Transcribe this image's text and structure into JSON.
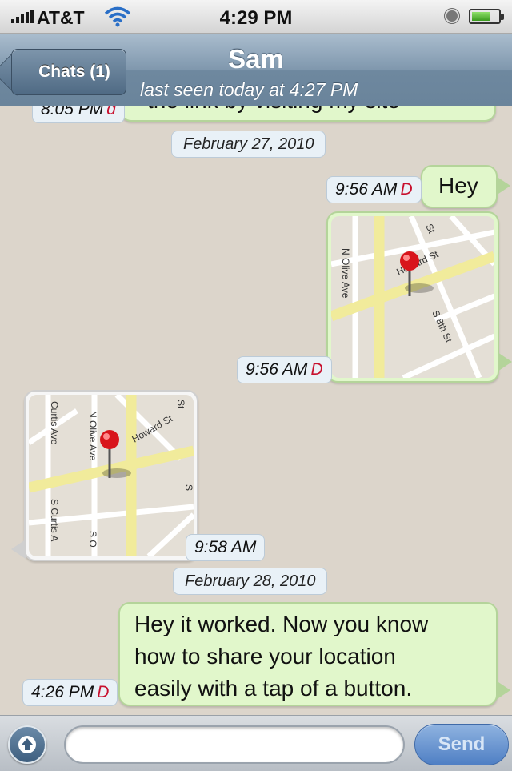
{
  "status_bar": {
    "carrier": "AT&T",
    "time": "4:29 PM"
  },
  "nav": {
    "back_label": "Chats (1)",
    "contact_name": "Sam",
    "last_seen": "last seen today at 4:27 PM"
  },
  "messages": {
    "partial_top": {
      "text": "the link by visiting my site",
      "time": "8:05 PM",
      "status": "d"
    },
    "date_1": "February 27, 2010",
    "msg_hey": {
      "text": "Hey",
      "time": "9:56 AM",
      "status": "D"
    },
    "map_out": {
      "time": "9:56 AM",
      "status": "D",
      "streets": [
        "N Olive Ave",
        "Howard St",
        "S 8th St",
        "St"
      ]
    },
    "map_in": {
      "time": "9:58 AM",
      "streets": [
        "Curtis Ave",
        "N Olive Ave",
        "Howard St",
        "S Curtis A",
        "S O",
        "St",
        "S"
      ]
    },
    "date_2": "February 28, 2010",
    "msg_worked": {
      "lines": [
        "Hey it worked.  Now you know",
        "how to share your location",
        "easily with a tap of a button."
      ],
      "time": "4:26 PM",
      "status": "D"
    }
  },
  "input": {
    "placeholder": "",
    "send_label": "Send"
  },
  "colors": {
    "background": "#dcd5cb",
    "outgoing_bubble": "#e1f7cb",
    "incoming_bubble": "#f6f6f6",
    "status_d": "#c8102e",
    "nav_bar": "#7f97ad"
  },
  "icons": {
    "signal": "signal-bars-icon",
    "wifi": "wifi-icon",
    "lock": "orientation-lock-icon",
    "battery": "battery-icon",
    "attach": "upload-arrow-icon",
    "pin": "map-pin-icon"
  }
}
